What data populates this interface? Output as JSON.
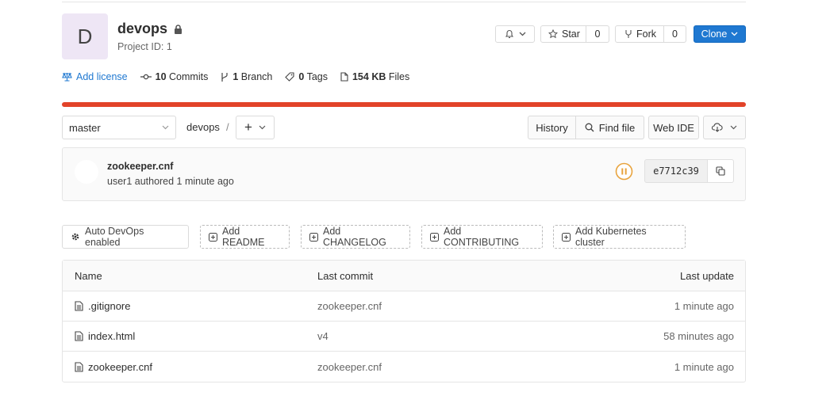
{
  "project": {
    "avatar_letter": "D",
    "name": "devops",
    "id_label": "Project ID: 1"
  },
  "actions": {
    "star_label": "Star",
    "star_count": "0",
    "fork_label": "Fork",
    "fork_count": "0",
    "clone_label": "Clone"
  },
  "stats": {
    "license_label": "Add license",
    "commits_count": "10",
    "commits_label": "Commits",
    "branch_count": "1",
    "branch_label": "Branch",
    "tags_count": "0",
    "tags_label": "Tags",
    "files_size": "154 KB",
    "files_label": "Files"
  },
  "language_bar_color": "#e24329",
  "toolbar": {
    "branch": "master",
    "path": "devops",
    "separator": "/",
    "add_label": "+",
    "history_label": "History",
    "find_file_label": "Find file",
    "web_ide_label": "Web IDE"
  },
  "last_commit": {
    "title": "zookeeper.cnf",
    "meta": "user1 authored 1 minute ago",
    "sha": "e7712c39"
  },
  "quick_actions": [
    {
      "label": "Auto DevOps enabled"
    },
    {
      "label": "Add README"
    },
    {
      "label": "Add CHANGELOG"
    },
    {
      "label": "Add CONTRIBUTING"
    },
    {
      "label": "Add Kubernetes cluster"
    }
  ],
  "files": {
    "headers": {
      "name": "Name",
      "last_commit": "Last commit",
      "last_update": "Last update"
    },
    "rows": [
      {
        "name": ".gitignore",
        "commit": "zookeeper.cnf",
        "updated": "1 minute ago"
      },
      {
        "name": "index.html",
        "commit": "v4",
        "updated": "58 minutes ago"
      },
      {
        "name": "zookeeper.cnf",
        "commit": "zookeeper.cnf",
        "updated": "1 minute ago"
      }
    ]
  },
  "colors": {
    "accent": "#1f78d1",
    "pipeline_status": "#e8a33d"
  }
}
